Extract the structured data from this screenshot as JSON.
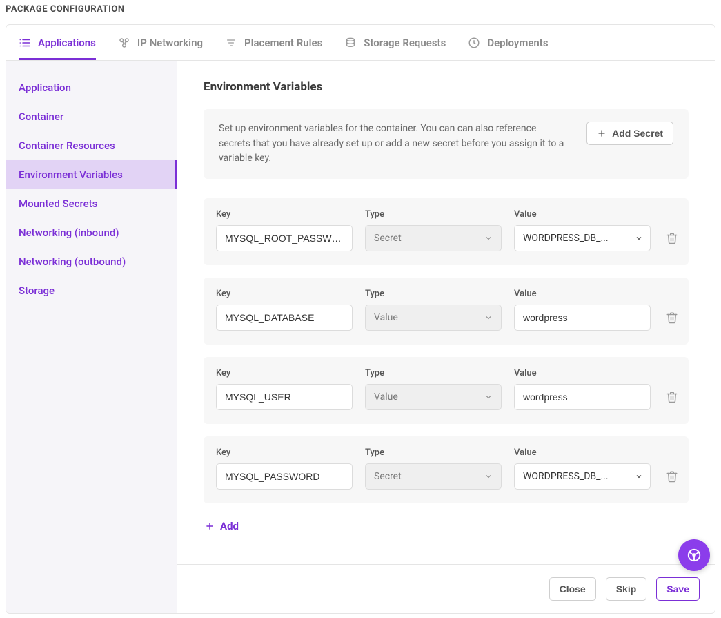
{
  "page_title": "PACKAGE CONFIGURATION",
  "tabs": [
    {
      "label": "Applications"
    },
    {
      "label": "IP Networking"
    },
    {
      "label": "Placement Rules"
    },
    {
      "label": "Storage Requests"
    },
    {
      "label": "Deployments"
    }
  ],
  "sidebar": {
    "items": [
      {
        "label": "Application"
      },
      {
        "label": "Container"
      },
      {
        "label": "Container Resources"
      },
      {
        "label": "Environment Variables"
      },
      {
        "label": "Mounted Secrets"
      },
      {
        "label": "Networking (inbound)"
      },
      {
        "label": "Networking (outbound)"
      },
      {
        "label": "Storage"
      }
    ]
  },
  "section": {
    "title": "Environment Variables",
    "info": "Set up environment variables for the container. You can can also reference secrets that you have already set up or add a new secret before you assign it to a variable key.",
    "add_secret_label": "Add Secret"
  },
  "labels": {
    "key": "Key",
    "type": "Type",
    "value": "Value",
    "add": "Add"
  },
  "vars": [
    {
      "key": "MYSQL_ROOT_PASSWORD",
      "type": "Secret",
      "value_mode": "select",
      "value": "WORDPRESS_DB_..."
    },
    {
      "key": "MYSQL_DATABASE",
      "type": "Value",
      "value_mode": "input",
      "value": "wordpress"
    },
    {
      "key": "MYSQL_USER",
      "type": "Value",
      "value_mode": "input",
      "value": "wordpress"
    },
    {
      "key": "MYSQL_PASSWORD",
      "type": "Secret",
      "value_mode": "select",
      "value": "WORDPRESS_DB_..."
    }
  ],
  "footer": {
    "close": "Close",
    "skip": "Skip",
    "save": "Save"
  }
}
